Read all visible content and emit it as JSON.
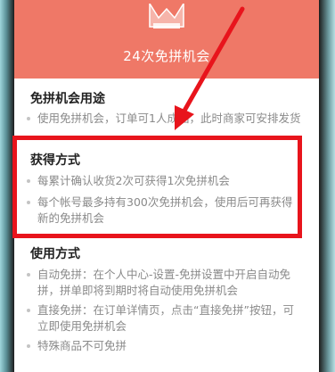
{
  "header": {
    "title": "24次免拼机会"
  },
  "sections": {
    "usage_purpose": {
      "title": "免拼机会用途",
      "items": [
        "使用免拼机会，订单可1人成团，此时商家可安排发货"
      ]
    },
    "obtain_method": {
      "title": "获得方式",
      "items": [
        "每累计确认收货2次可获得1次免拼机会",
        "每个帐号最多持有300次免拼机会，使用后可再获得",
        "新的免拼机会"
      ]
    },
    "usage_method": {
      "title": "使用方式",
      "items": [
        "自动免拼：在个人中心-设置-免拼设置中开启自动免",
        "拼，拼单即将到期时将自动使用免拼机会",
        "直接免拼：在订单详情页，点击“直接免拼”按钮，可",
        "立即使用免拼机会",
        "特殊商品不可免拼"
      ]
    }
  },
  "colors": {
    "header_bg": "#ef7867",
    "highlight_box": "#e8141c",
    "annotation_arrow": "#e8141c"
  }
}
